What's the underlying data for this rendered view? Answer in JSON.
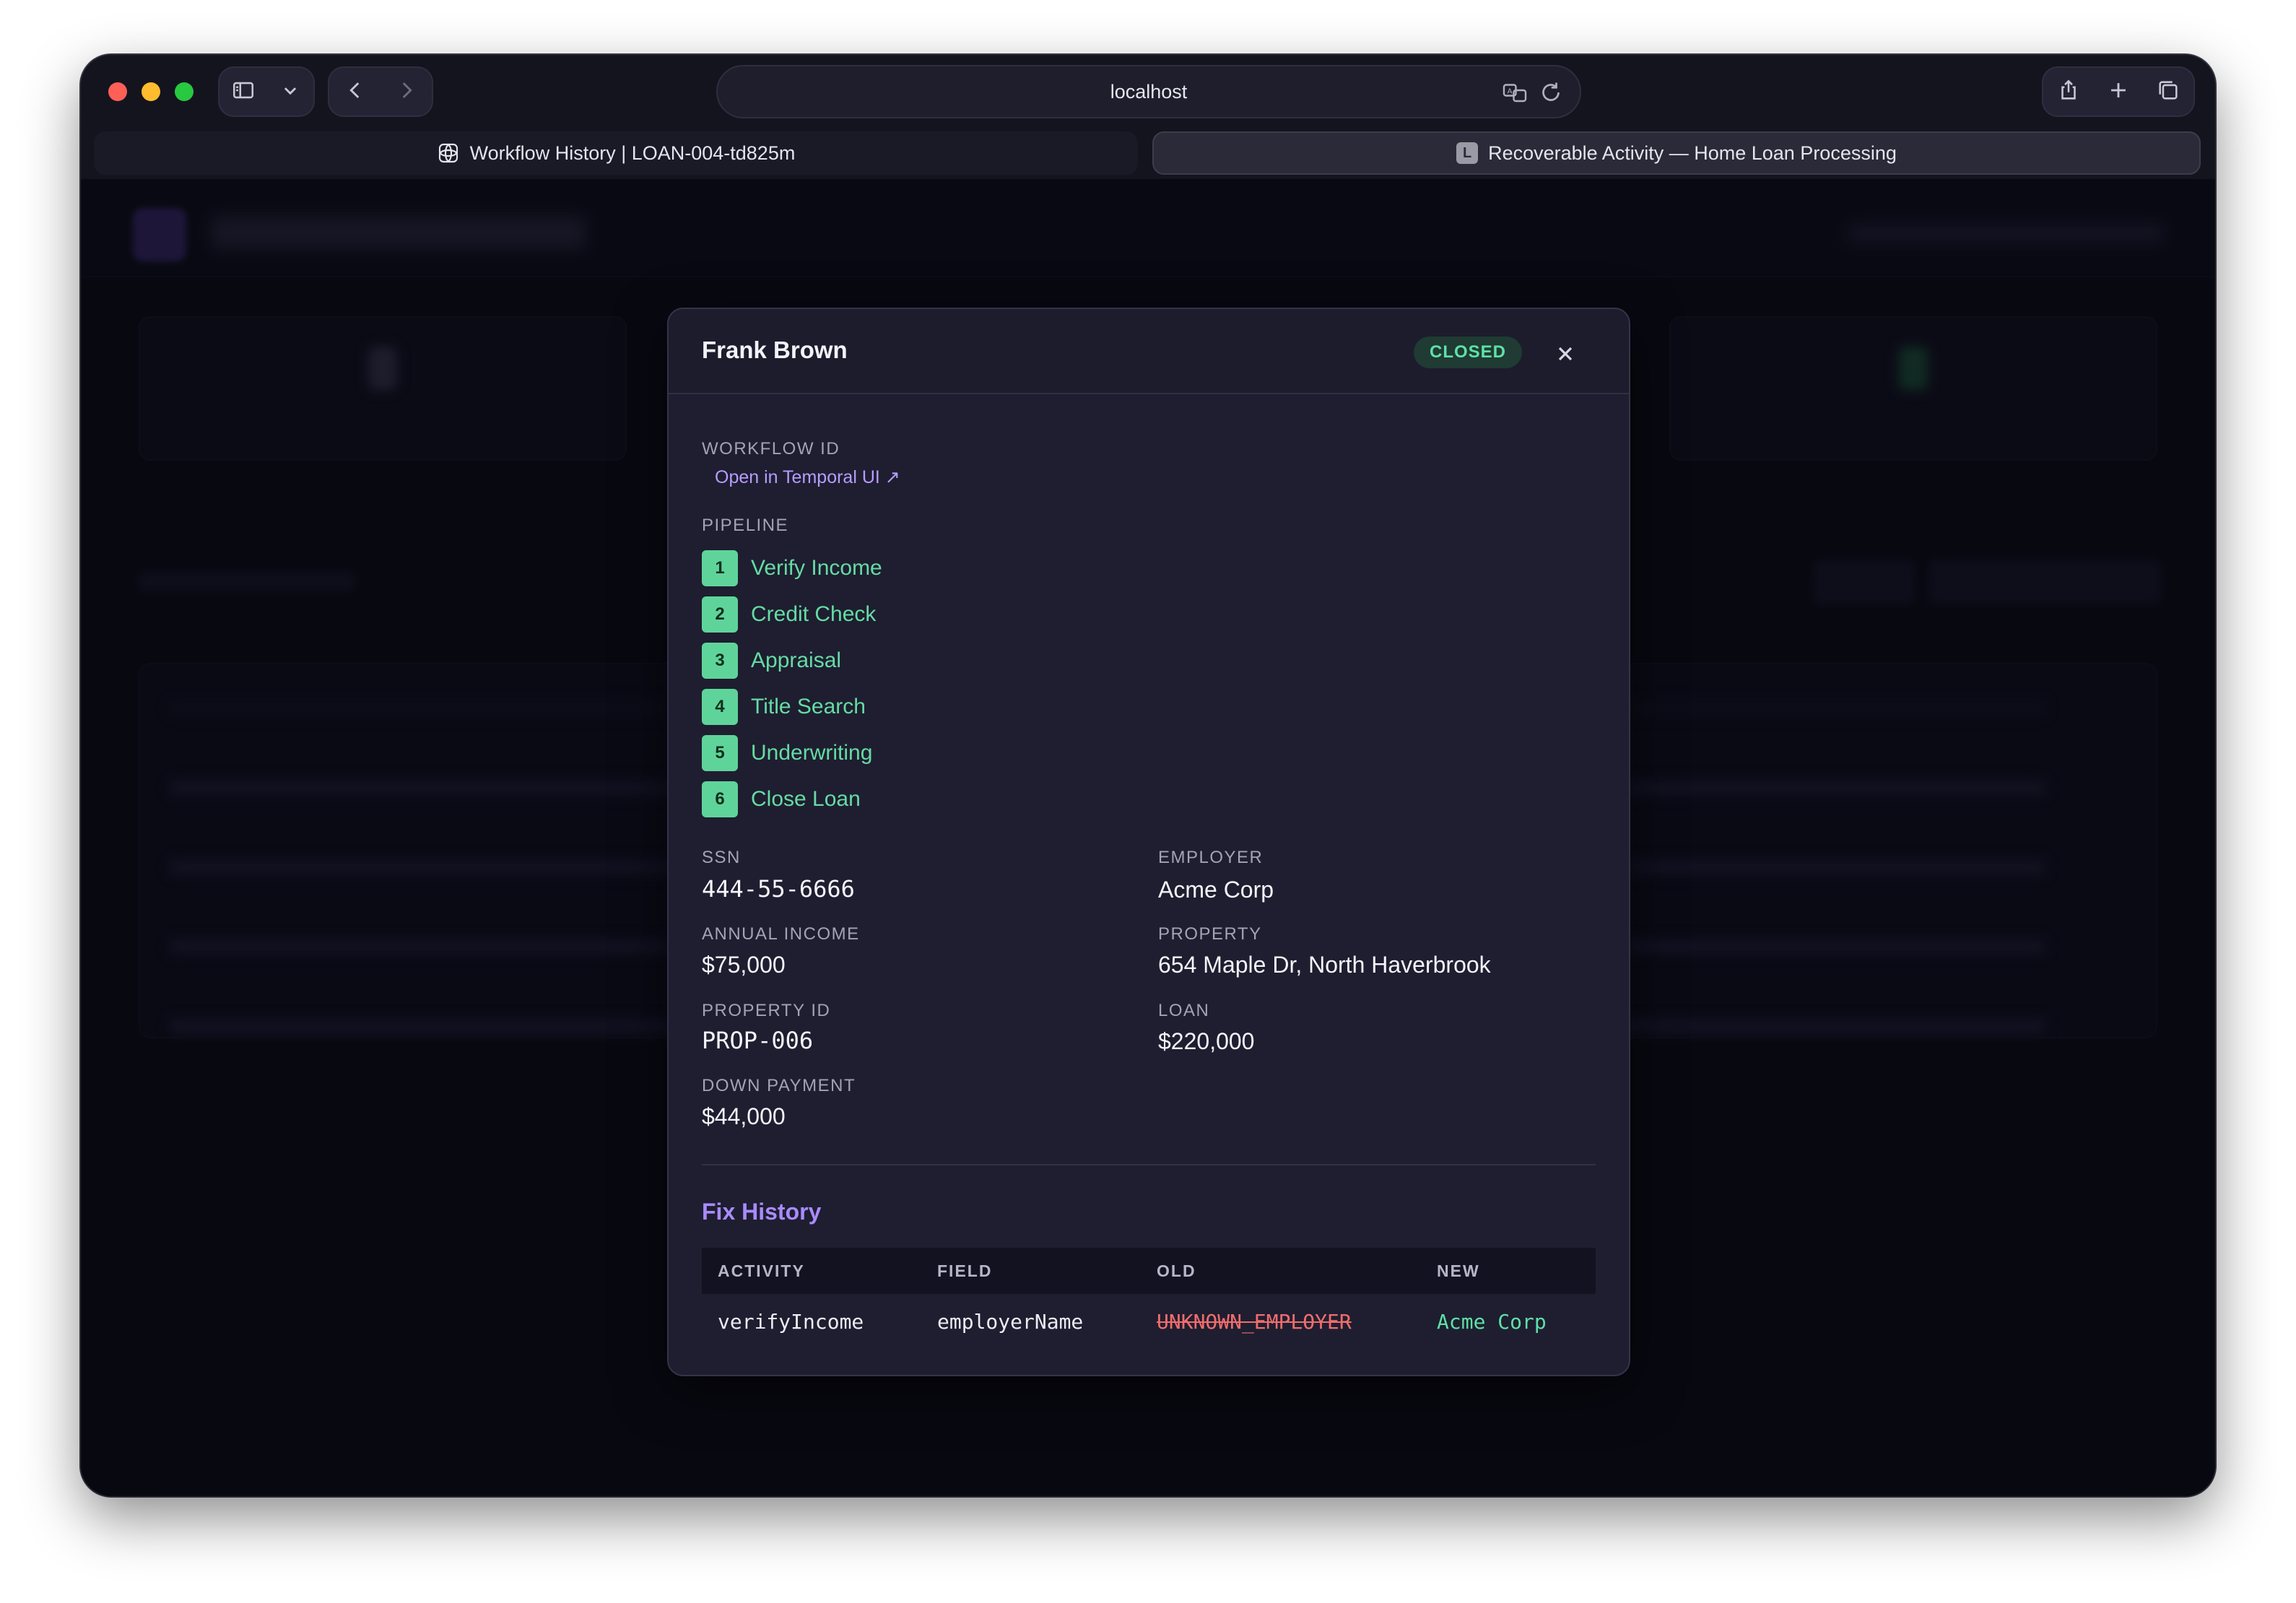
{
  "browser": {
    "url": "localhost",
    "tabs": [
      {
        "label": "Workflow History | LOAN-004-td825m"
      },
      {
        "label": "Recoverable Activity — Home Loan Processing",
        "favicon_letter": "L"
      }
    ]
  },
  "modal": {
    "title": "Frank Brown",
    "status": "CLOSED",
    "workflow_id_label": "WORKFLOW ID",
    "temporal_link": "Open in Temporal UI ↗",
    "pipeline_label": "PIPELINE",
    "pipeline": [
      {
        "num": "1",
        "name": "Verify Income"
      },
      {
        "num": "2",
        "name": "Credit Check"
      },
      {
        "num": "3",
        "name": "Appraisal"
      },
      {
        "num": "4",
        "name": "Title Search"
      },
      {
        "num": "5",
        "name": "Underwriting"
      },
      {
        "num": "6",
        "name": "Close Loan"
      }
    ],
    "fields": {
      "ssn": {
        "label": "SSN",
        "value": "444-55-6666"
      },
      "employer": {
        "label": "EMPLOYER",
        "value": "Acme Corp"
      },
      "annual_income": {
        "label": "ANNUAL INCOME",
        "value": "$75,000"
      },
      "property": {
        "label": "PROPERTY",
        "value": "654 Maple Dr, North Haverbrook"
      },
      "property_id": {
        "label": "PROPERTY ID",
        "value": "PROP-006"
      },
      "loan": {
        "label": "LOAN",
        "value": "$220,000"
      },
      "down_payment": {
        "label": "DOWN PAYMENT",
        "value": "$44,000"
      }
    },
    "fix_history": {
      "title": "Fix History",
      "columns": [
        "ACTIVITY",
        "FIELD",
        "OLD",
        "NEW"
      ],
      "rows": [
        {
          "activity": "verifyIncome",
          "field": "employerName",
          "old": "UNKNOWN_EMPLOYER",
          "new": "Acme Corp"
        }
      ]
    }
  },
  "colors": {
    "accent": "#a98bff",
    "success": "#5fe0a7",
    "error": "#f06d6d",
    "modal_bg": "#1e1e30"
  }
}
